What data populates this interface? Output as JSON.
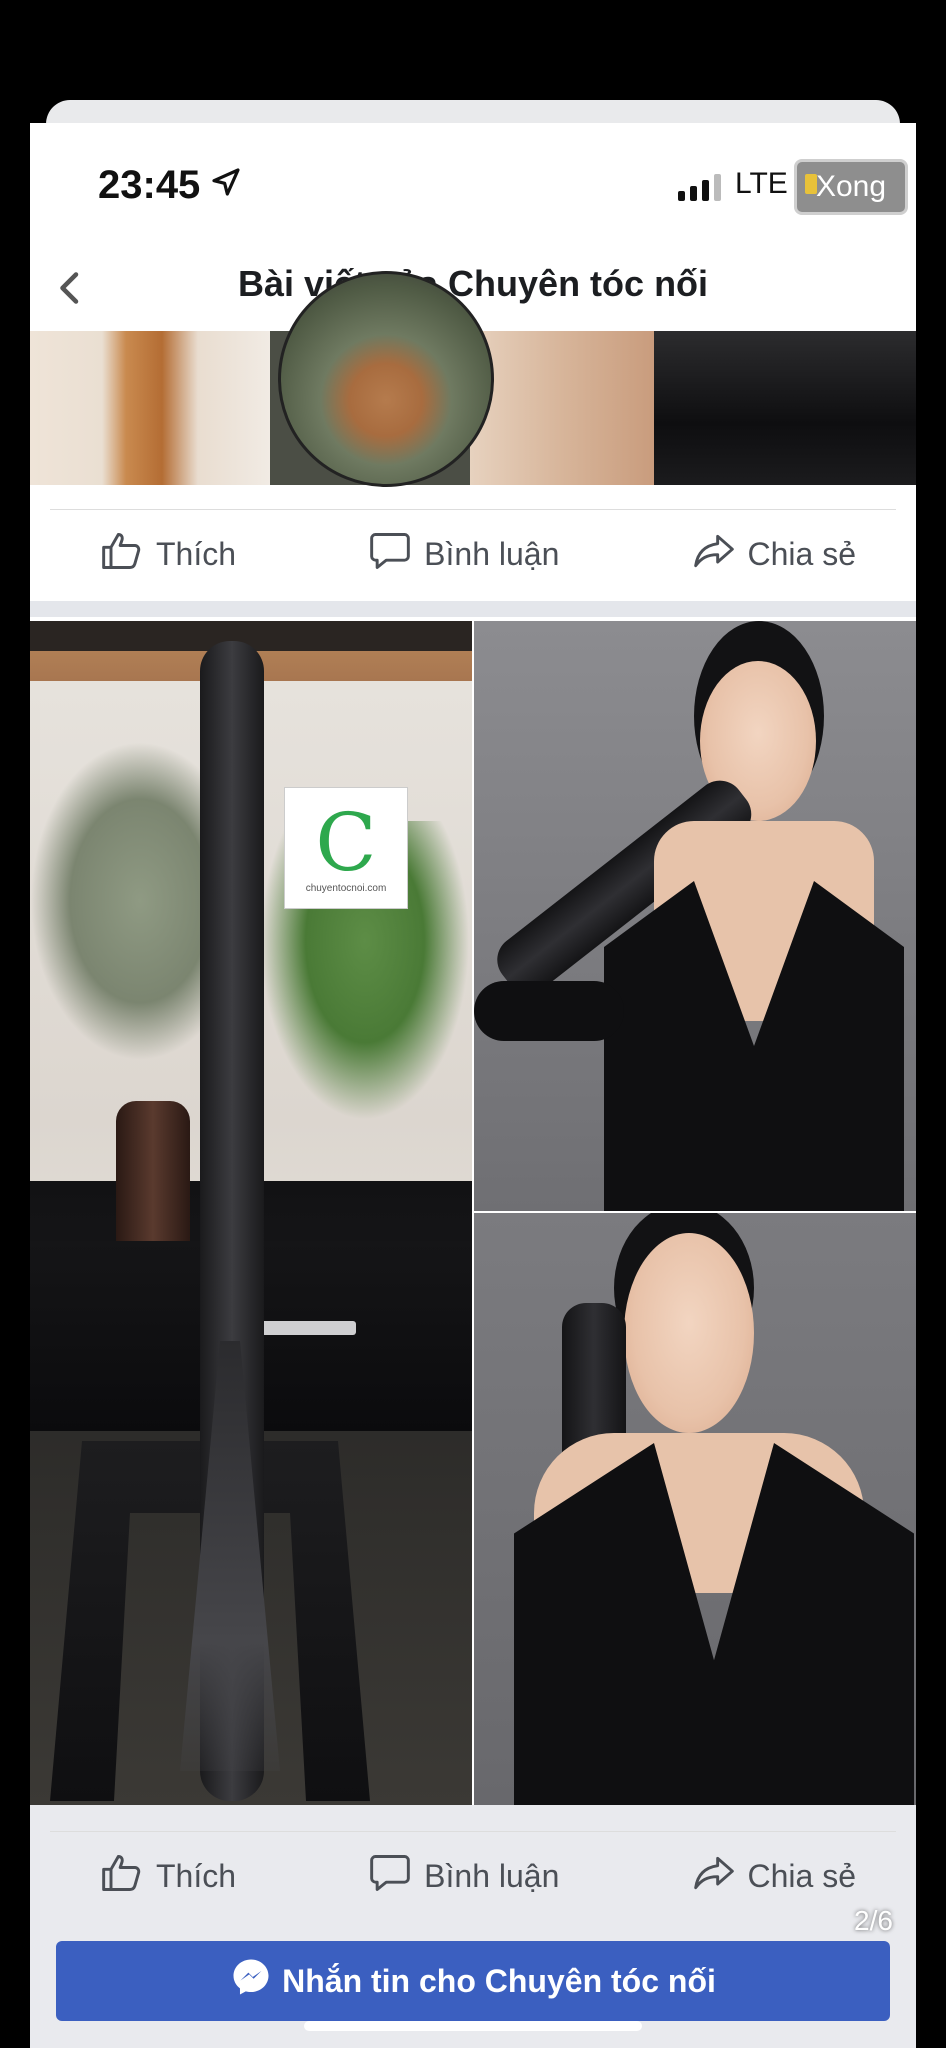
{
  "status_bar": {
    "time": "23:45",
    "network": "LTE",
    "done_label": "Xong"
  },
  "nav": {
    "title": "Bài viết của Chuyên tóc nối"
  },
  "post_actions": {
    "like": "Thích",
    "comment": "Bình luận",
    "share": "Chia sẻ"
  },
  "post_actions_bottom": {
    "like": "Thích",
    "comment": "Bình luận",
    "share": "Chia sẻ"
  },
  "watermark": {
    "url": "chuyentocnoi.com"
  },
  "gallery": {
    "counter": "2/6"
  },
  "messenger": {
    "label": "Nhắn tin cho Chuyên tóc nối"
  },
  "icons": [
    "location-arrow-icon",
    "signal-icon",
    "back-chevron-icon",
    "like-icon",
    "comment-icon",
    "share-icon",
    "messenger-icon"
  ]
}
